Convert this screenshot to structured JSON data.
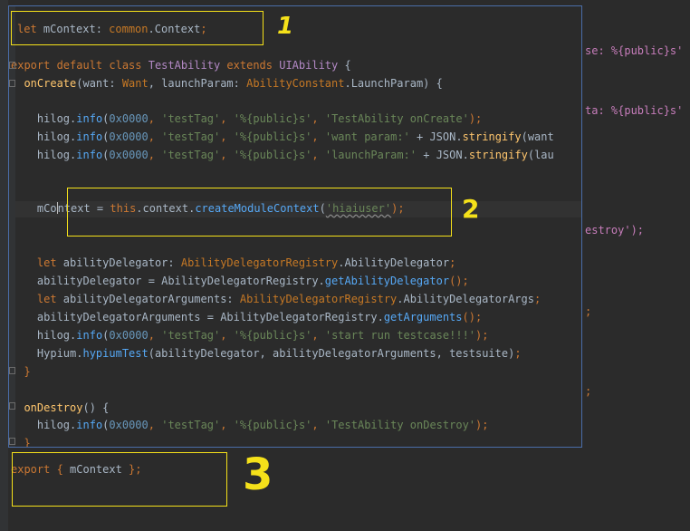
{
  "editor": {
    "popup_lines": [
      {
        "tokens": [
          {
            "t": "let ",
            "c": "kw"
          },
          {
            "t": "mContext",
            "c": "id"
          },
          {
            "t": ": ",
            "c": "id"
          },
          {
            "t": "common",
            "c": "type"
          },
          {
            "t": ".",
            "c": "id"
          },
          {
            "t": "Context",
            "c": "id"
          },
          {
            "t": ";",
            "c": "kw"
          }
        ]
      },
      {
        "tokens": [
          {
            "t": "export default class ",
            "c": "kw"
          },
          {
            "t": "TestAbility ",
            "c": "cls"
          },
          {
            "t": "extends ",
            "c": "kw"
          },
          {
            "t": "UIAbility ",
            "c": "cls"
          },
          {
            "t": "{",
            "c": "id"
          }
        ]
      },
      {
        "tokens": [
          {
            "t": "  onCreate",
            "c": "fn"
          },
          {
            "t": "(want: ",
            "c": "id"
          },
          {
            "t": "Want",
            "c": "type"
          },
          {
            "t": ", launchParam: ",
            "c": "id"
          },
          {
            "t": "AbilityConstant",
            "c": "type"
          },
          {
            "t": ".LaunchParam) {",
            "c": "id"
          }
        ]
      },
      {
        "tokens": [
          {
            "t": "    hilog",
            "c": "id"
          },
          {
            "t": ".",
            "c": "id"
          },
          {
            "t": "info",
            "c": "mth"
          },
          {
            "t": "(",
            "c": "id"
          },
          {
            "t": "0x0000",
            "c": "numlit"
          },
          {
            "t": ", ",
            "c": "kw"
          },
          {
            "t": "'testTag'",
            "c": "str"
          },
          {
            "t": ", ",
            "c": "kw"
          },
          {
            "t": "'%{public}s'",
            "c": "str"
          },
          {
            "t": ", ",
            "c": "kw"
          },
          {
            "t": "'TestAbility onCreate'",
            "c": "str"
          },
          {
            "t": ");",
            "c": "kw"
          }
        ]
      },
      {
        "tokens": [
          {
            "t": "    hilog",
            "c": "id"
          },
          {
            "t": ".",
            "c": "id"
          },
          {
            "t": "info",
            "c": "mth"
          },
          {
            "t": "(",
            "c": "id"
          },
          {
            "t": "0x0000",
            "c": "numlit"
          },
          {
            "t": ", ",
            "c": "kw"
          },
          {
            "t": "'testTag'",
            "c": "str"
          },
          {
            "t": ", ",
            "c": "kw"
          },
          {
            "t": "'%{public}s'",
            "c": "str"
          },
          {
            "t": ", ",
            "c": "kw"
          },
          {
            "t": "'want param:'",
            "c": "str"
          },
          {
            "t": " + JSON.",
            "c": "id"
          },
          {
            "t": "stringify",
            "c": "fn"
          },
          {
            "t": "(want",
            "c": "id"
          }
        ]
      },
      {
        "tokens": [
          {
            "t": "    hilog",
            "c": "id"
          },
          {
            "t": ".",
            "c": "id"
          },
          {
            "t": "info",
            "c": "mth"
          },
          {
            "t": "(",
            "c": "id"
          },
          {
            "t": "0x0000",
            "c": "numlit"
          },
          {
            "t": ", ",
            "c": "kw"
          },
          {
            "t": "'testTag'",
            "c": "str"
          },
          {
            "t": ", ",
            "c": "kw"
          },
          {
            "t": "'%{public}s'",
            "c": "str"
          },
          {
            "t": ", ",
            "c": "kw"
          },
          {
            "t": "'launchParam:'",
            "c": "str"
          },
          {
            "t": " + JSON.",
            "c": "id"
          },
          {
            "t": "stringify",
            "c": "fn"
          },
          {
            "t": "(lau",
            "c": "id"
          }
        ]
      },
      {
        "tokens": [
          {
            "t": "    mCo",
            "c": "id"
          },
          {
            "t": "CARET",
            "c": "caret"
          },
          {
            "t": "ntext",
            "c": "id"
          },
          {
            "t": " = ",
            "c": "id"
          },
          {
            "t": "this",
            "c": "kw"
          },
          {
            "t": ".context.",
            "c": "id"
          },
          {
            "t": "createModuleContext",
            "c": "mth"
          },
          {
            "t": "(",
            "c": "id"
          },
          {
            "t": "'hiaiuser'",
            "c": "str squig"
          },
          {
            "t": ");",
            "c": "kw"
          }
        ]
      },
      {
        "tokens": [
          {
            "t": "    let ",
            "c": "kw"
          },
          {
            "t": "abilityDelegator: ",
            "c": "id"
          },
          {
            "t": "AbilityDelegatorRegistry",
            "c": "type"
          },
          {
            "t": ".AbilityDelegator",
            "c": "id"
          },
          {
            "t": ";",
            "c": "kw"
          }
        ]
      },
      {
        "tokens": [
          {
            "t": "    abilityDelegator = AbilityDelegatorRegistry.",
            "c": "id"
          },
          {
            "t": "getAbilityDelegator",
            "c": "mth"
          },
          {
            "t": "();",
            "c": "kw"
          }
        ]
      },
      {
        "tokens": [
          {
            "t": "    let ",
            "c": "kw"
          },
          {
            "t": "abilityDelegatorArguments: ",
            "c": "id"
          },
          {
            "t": "AbilityDelegatorRegistry",
            "c": "type"
          },
          {
            "t": ".AbilityDelegatorArgs",
            "c": "id"
          },
          {
            "t": ";",
            "c": "kw"
          }
        ]
      },
      {
        "tokens": [
          {
            "t": "    abilityDelegatorArguments = AbilityDelegatorRegistry.",
            "c": "id"
          },
          {
            "t": "getArguments",
            "c": "mth"
          },
          {
            "t": "();",
            "c": "kw"
          }
        ]
      },
      {
        "tokens": [
          {
            "t": "    hilog",
            "c": "id"
          },
          {
            "t": ".",
            "c": "id"
          },
          {
            "t": "info",
            "c": "mth"
          },
          {
            "t": "(",
            "c": "id"
          },
          {
            "t": "0x0000",
            "c": "numlit"
          },
          {
            "t": ", ",
            "c": "kw"
          },
          {
            "t": "'testTag'",
            "c": "str"
          },
          {
            "t": ", ",
            "c": "kw"
          },
          {
            "t": "'%{public}s'",
            "c": "str"
          },
          {
            "t": ", ",
            "c": "kw"
          },
          {
            "t": "'start run testcase!!!'",
            "c": "str"
          },
          {
            "t": ");",
            "c": "kw"
          }
        ]
      },
      {
        "tokens": [
          {
            "t": "    Hypium.",
            "c": "id"
          },
          {
            "t": "hypiumTest",
            "c": "mth"
          },
          {
            "t": "(abilityDelegator, abilityDelegatorArguments, testsuite)",
            "c": "id"
          },
          {
            "t": ";",
            "c": "kw"
          }
        ]
      },
      {
        "tokens": [
          {
            "t": "  }",
            "c": "kw"
          }
        ]
      },
      {
        "tokens": [
          {
            "t": "  onDestroy",
            "c": "fn"
          },
          {
            "t": "() {",
            "c": "id"
          }
        ]
      },
      {
        "tokens": [
          {
            "t": "    hilog",
            "c": "id"
          },
          {
            "t": ".",
            "c": "id"
          },
          {
            "t": "info",
            "c": "mth"
          },
          {
            "t": "(",
            "c": "id"
          },
          {
            "t": "0x0000",
            "c": "numlit"
          },
          {
            "t": ", ",
            "c": "kw"
          },
          {
            "t": "'testTag'",
            "c": "str"
          },
          {
            "t": ", ",
            "c": "kw"
          },
          {
            "t": "'%{public}s'",
            "c": "str"
          },
          {
            "t": ", ",
            "c": "kw"
          },
          {
            "t": "'TestAbility onDestroy'",
            "c": "str"
          },
          {
            "t": ");",
            "c": "kw"
          }
        ]
      },
      {
        "tokens": [
          {
            "t": "  }",
            "c": "kw"
          }
        ]
      }
    ],
    "export_line": [
      {
        "t": "export ",
        "c": "kw"
      },
      {
        "t": "{ ",
        "c": "kw"
      },
      {
        "t": "mContext",
        "c": "id"
      },
      {
        "t": " };",
        "c": "kw"
      }
    ],
    "background_fragments": [
      {
        "text": "se: %{public}s'",
        "c": "pur"
      },
      {
        "text": "ta: %{public}s'",
        "c": "pur"
      },
      {
        "text": "estroy');",
        "c": "pur"
      },
      {
        "text": ";",
        "c": "kw"
      },
      {
        "text": ";",
        "c": "kw"
      }
    ]
  },
  "annotations": {
    "labels": [
      "1",
      "2",
      "3"
    ],
    "color": "#f5e11a"
  }
}
